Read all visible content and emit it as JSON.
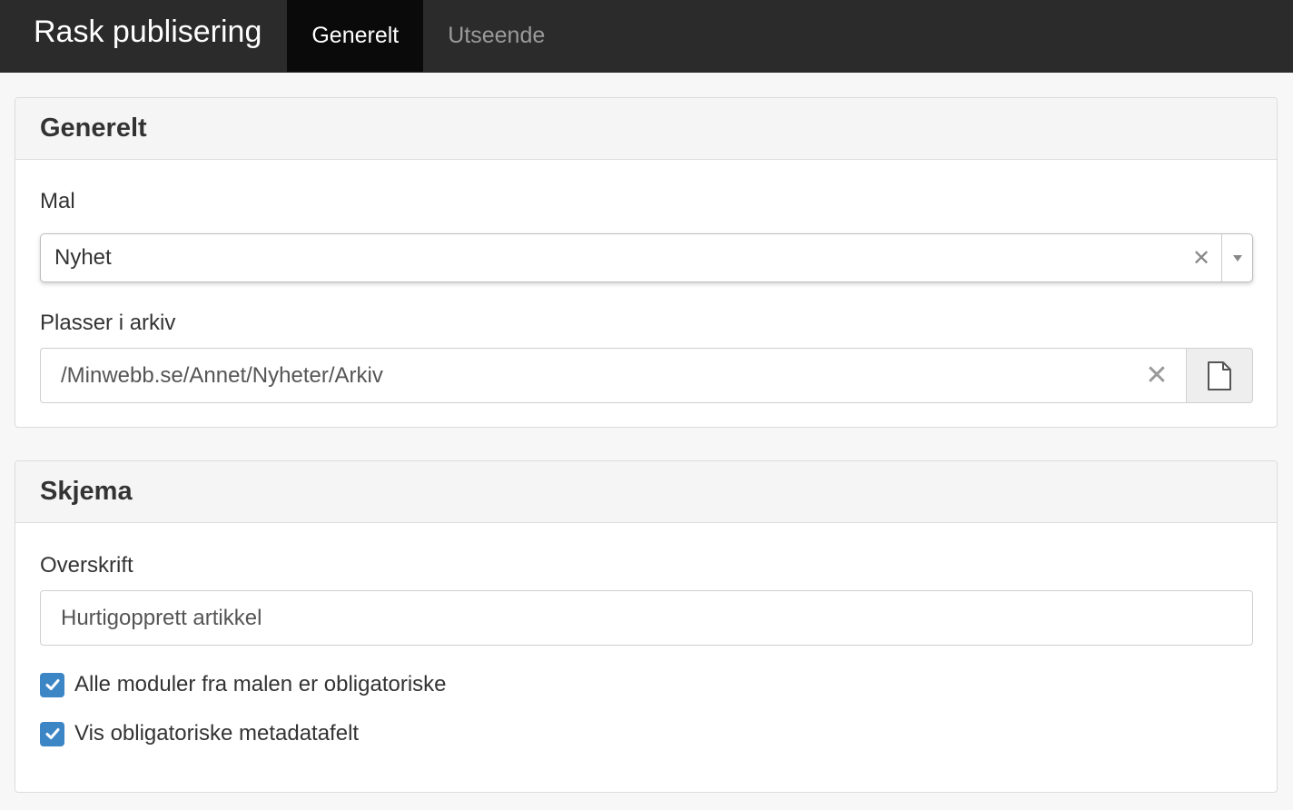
{
  "header": {
    "app_title": "Rask publisering",
    "tabs": [
      {
        "label": "Generelt",
        "active": true
      },
      {
        "label": "Utseende",
        "active": false
      }
    ]
  },
  "general_panel": {
    "title": "Generelt",
    "template_label": "Mal",
    "template_value": "Nyhet",
    "archive_label": "Plasser i arkiv",
    "archive_value": "/Minwebb.se/Annet/Nyheter/Arkiv"
  },
  "form_panel": {
    "title": "Skjema",
    "heading_label": "Overskrift",
    "heading_value": "Hurtigopprett artikkel",
    "checkboxes": [
      {
        "label": "Alle moduler fra malen er obligatoriske",
        "checked": true
      },
      {
        "label": "Vis obligatoriske metadatafelt",
        "checked": true
      }
    ]
  },
  "icons": {
    "clear": "close-icon",
    "dropdown": "chevron-down-icon",
    "browse": "file-icon",
    "check": "check-icon"
  },
  "colors": {
    "topbar": "#2b2b2b",
    "active_tab": "#0a0a0a",
    "checkbox": "#3d86c6"
  }
}
